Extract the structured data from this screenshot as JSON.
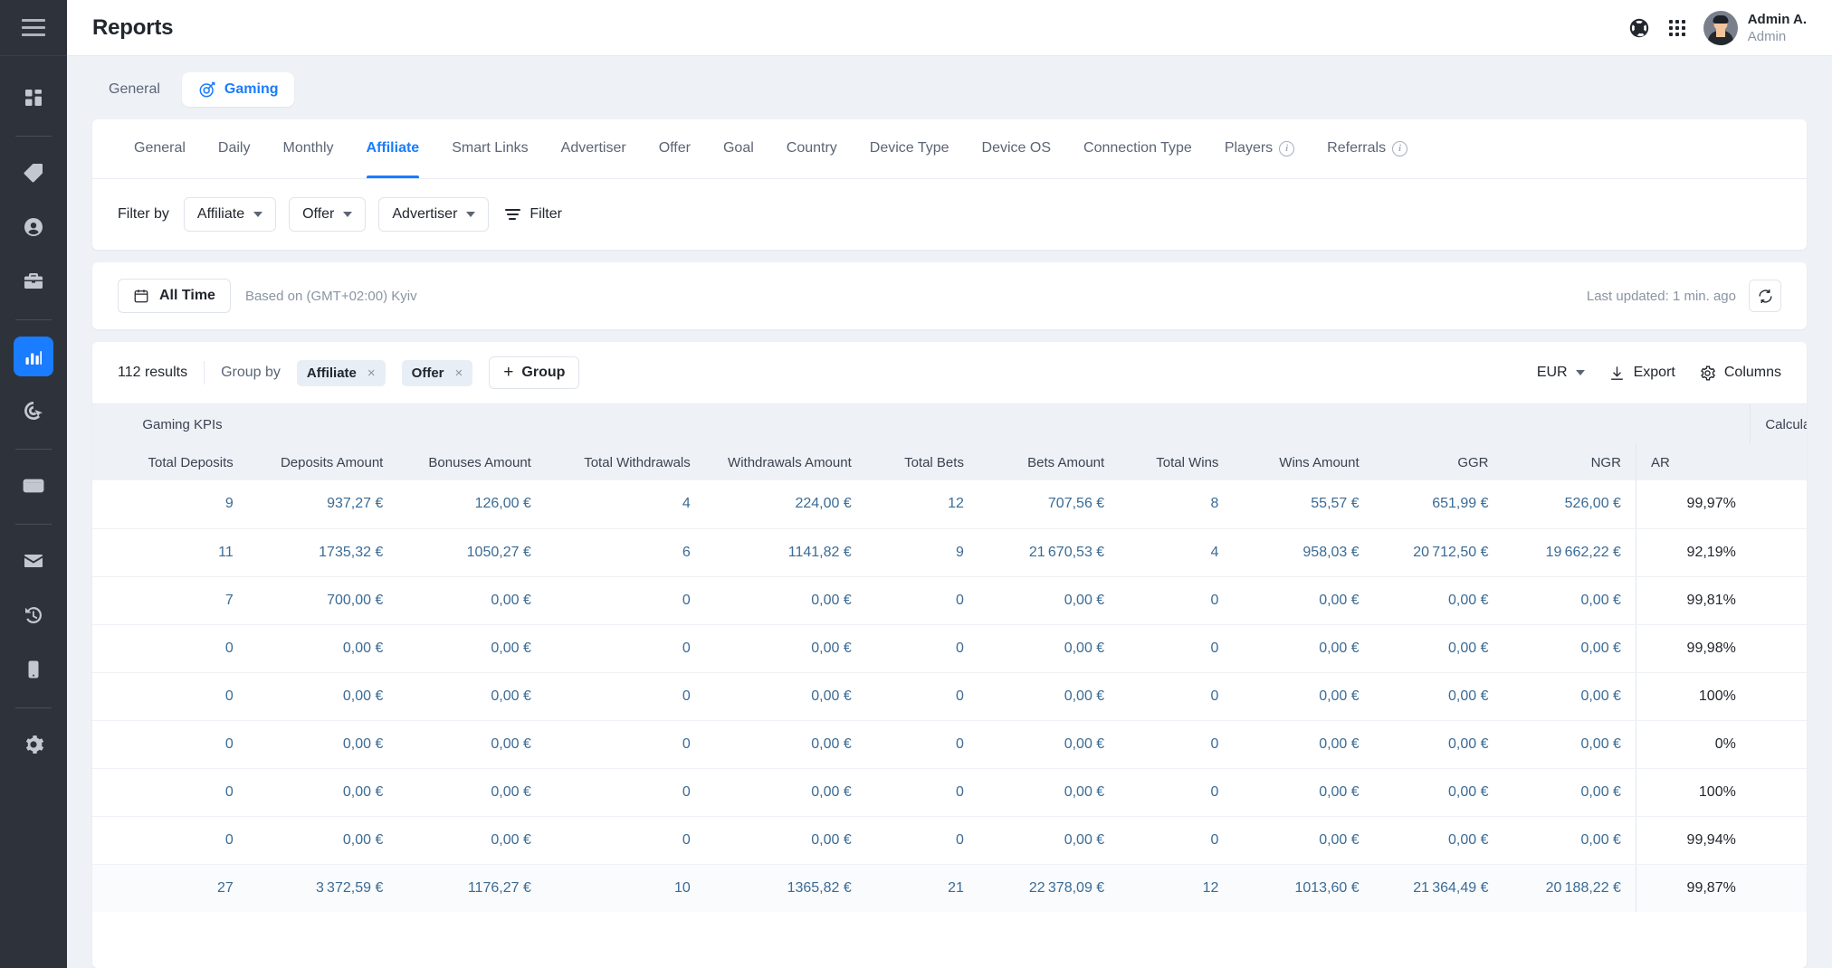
{
  "app": {
    "page_title": "Reports",
    "user": {
      "name": "Admin A.",
      "role": "Admin"
    }
  },
  "sidebar": {
    "items": [
      {
        "name": "menu-toggle",
        "icon": "hamburger-icon"
      },
      {
        "name": "dashboard",
        "icon": "dashboard-icon",
        "active": false
      },
      {
        "name": "offers",
        "icon": "tag-icon",
        "active": false
      },
      {
        "name": "affiliates",
        "icon": "person-icon",
        "active": false
      },
      {
        "name": "advertisers",
        "icon": "briefcase-icon",
        "active": false
      },
      {
        "name": "reports",
        "icon": "bar-chart-icon",
        "active": true
      },
      {
        "name": "conversions",
        "icon": "target-click-icon",
        "active": false
      },
      {
        "name": "billing",
        "icon": "credit-card-icon",
        "active": false
      },
      {
        "name": "messages",
        "icon": "mail-icon",
        "active": false
      },
      {
        "name": "activity-log",
        "icon": "history-icon",
        "active": false
      },
      {
        "name": "mobile",
        "icon": "smartphone-icon",
        "active": false
      },
      {
        "name": "settings",
        "icon": "gear-icon",
        "active": false
      }
    ]
  },
  "header": {
    "help_icon": "lifebuoy-icon",
    "apps_icon": "apps-grid-icon"
  },
  "section_tabs": [
    {
      "label": "General",
      "active": false
    },
    {
      "label": "Gaming",
      "active": true,
      "icon": "gaming-target-icon"
    }
  ],
  "report_tabs": [
    {
      "label": "General",
      "active": false,
      "info": false
    },
    {
      "label": "Daily",
      "active": false,
      "info": false
    },
    {
      "label": "Monthly",
      "active": false,
      "info": false
    },
    {
      "label": "Affiliate",
      "active": true,
      "info": false
    },
    {
      "label": "Smart Links",
      "active": false,
      "info": false
    },
    {
      "label": "Advertiser",
      "active": false,
      "info": false
    },
    {
      "label": "Offer",
      "active": false,
      "info": false
    },
    {
      "label": "Goal",
      "active": false,
      "info": false
    },
    {
      "label": "Country",
      "active": false,
      "info": false
    },
    {
      "label": "Device Type",
      "active": false,
      "info": false
    },
    {
      "label": "Device OS",
      "active": false,
      "info": false
    },
    {
      "label": "Connection Type",
      "active": false,
      "info": false
    },
    {
      "label": "Players",
      "active": false,
      "info": true
    },
    {
      "label": "Referrals",
      "active": false,
      "info": true
    }
  ],
  "filter_bar": {
    "label": "Filter by",
    "selects": [
      {
        "label": "Affiliate"
      },
      {
        "label": "Offer"
      },
      {
        "label": "Advertiser"
      }
    ],
    "filter_label": "Filter"
  },
  "date_bar": {
    "range_label": "All Time",
    "calendar_icon": "calendar-icon",
    "timezone_note": "Based on (GMT+02:00) Kyiv",
    "last_updated": "Last updated: 1 min. ago",
    "refresh_icon": "refresh-icon"
  },
  "table_bar": {
    "results": "112 results",
    "group_by_label": "Group by",
    "group_chips": [
      {
        "label": "Affiliate",
        "remove": "×"
      },
      {
        "label": "Offer",
        "remove": "×"
      }
    ],
    "add_group_label": "Group",
    "currency": "EUR",
    "export_label": "Export",
    "columns_label": "Columns"
  },
  "table": {
    "group_headers": [
      {
        "label": "Gaming KPIs",
        "span": 13
      },
      {
        "label": "Calculations",
        "span": 1
      }
    ],
    "columns": [
      "Total Deposits",
      "Deposits Amount",
      "Bonuses Amount",
      "Total Withdrawals",
      "Withdrawals Amount",
      "Total Bets",
      "Bets Amount",
      "Total Wins",
      "Wins Amount",
      "GGR",
      "NGR",
      "AR"
    ],
    "rows": [
      [
        "9",
        "937,27 €",
        "126,00 €",
        "4",
        "224,00 €",
        "12",
        "707,56 €",
        "8",
        "55,57 €",
        "651,99 €",
        "526,00 €",
        "99,97%"
      ],
      [
        "11",
        "1735,32 €",
        "1050,27 €",
        "6",
        "1141,82 €",
        "9",
        "21 670,53 €",
        "4",
        "958,03 €",
        "20 712,50 €",
        "19 662,22 €",
        "92,19%"
      ],
      [
        "7",
        "700,00 €",
        "0,00 €",
        "0",
        "0,00 €",
        "0",
        "0,00 €",
        "0",
        "0,00 €",
        "0,00 €",
        "0,00 €",
        "99,81%"
      ],
      [
        "0",
        "0,00 €",
        "0,00 €",
        "0",
        "0,00 €",
        "0",
        "0,00 €",
        "0",
        "0,00 €",
        "0,00 €",
        "0,00 €",
        "99,98%"
      ],
      [
        "0",
        "0,00 €",
        "0,00 €",
        "0",
        "0,00 €",
        "0",
        "0,00 €",
        "0",
        "0,00 €",
        "0,00 €",
        "0,00 €",
        "100%"
      ],
      [
        "0",
        "0,00 €",
        "0,00 €",
        "0",
        "0,00 €",
        "0",
        "0,00 €",
        "0",
        "0,00 €",
        "0,00 €",
        "0,00 €",
        "0%"
      ],
      [
        "0",
        "0,00 €",
        "0,00 €",
        "0",
        "0,00 €",
        "0",
        "0,00 €",
        "0",
        "0,00 €",
        "0,00 €",
        "0,00 €",
        "100%"
      ],
      [
        "0",
        "0,00 €",
        "0,00 €",
        "0",
        "0,00 €",
        "0",
        "0,00 €",
        "0",
        "0,00 €",
        "0,00 €",
        "0,00 €",
        "99,94%"
      ]
    ],
    "total_row": [
      "27",
      "3 372,59 €",
      "1176,27 €",
      "10",
      "1365,82 €",
      "21",
      "22 378,09 €",
      "12",
      "1013,60 €",
      "21 364,49 €",
      "20 188,22 €",
      "99,87%"
    ]
  },
  "colors": {
    "accent": "#1a7cff",
    "value_blue": "#3a6b96",
    "sidebar_bg": "#2e333b",
    "page_bg": "#eef2f6"
  }
}
